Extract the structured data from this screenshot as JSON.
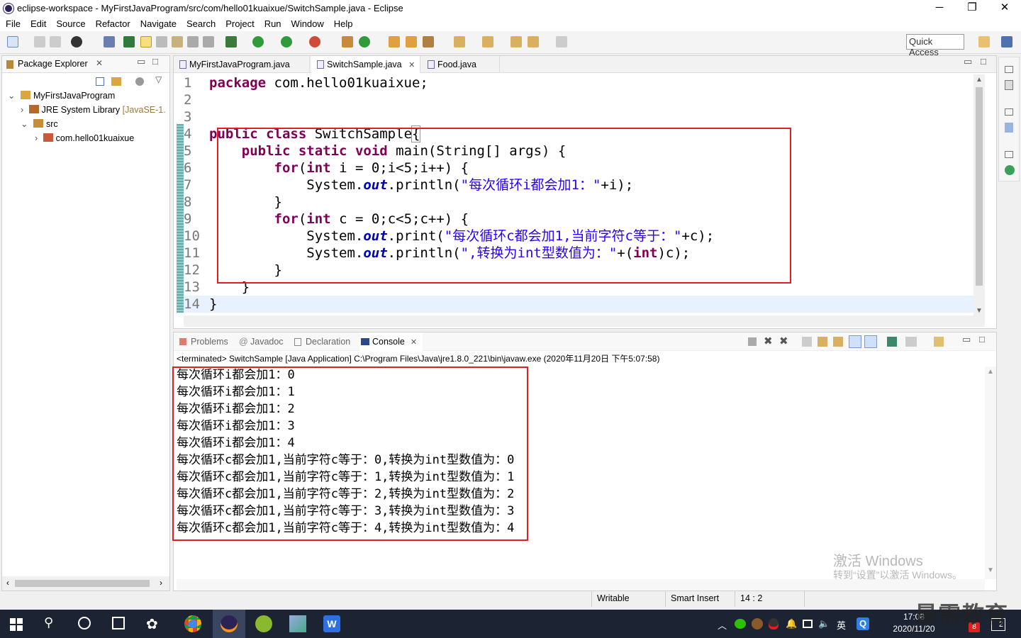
{
  "window": {
    "title": "eclipse-workspace - MyFirstJavaProgram/src/com/hello01kuaixue/SwitchSample.java - Eclipse"
  },
  "menu": [
    "File",
    "Edit",
    "Source",
    "Refactor",
    "Navigate",
    "Search",
    "Project",
    "Run",
    "Window",
    "Help"
  ],
  "quick_access": "Quick Access",
  "package_explorer": {
    "title": "Package Explorer",
    "tree": [
      {
        "label": "MyFirstJavaProgram"
      },
      {
        "label": "JRE System Library",
        "suffix": "[JavaSE-1."
      },
      {
        "label": "src"
      },
      {
        "label": "com.hello01kuaixue"
      }
    ]
  },
  "editor": {
    "tabs": [
      "MyFirstJavaProgram.java",
      "SwitchSample.java",
      "Food.java"
    ],
    "active_tab": 1,
    "line_numbers": [
      "1",
      "2",
      "3",
      "4",
      "5",
      "6",
      "7",
      "8",
      "9",
      "10",
      "11",
      "12",
      "13",
      "14"
    ]
  },
  "console": {
    "tabs": [
      "Problems",
      "Javadoc",
      "Declaration",
      "Console"
    ],
    "status": "<terminated> SwitchSample [Java Application] C:\\Program Files\\Java\\jre1.8.0_221\\bin\\javaw.exe (2020年11月20日 下午5:07:58)",
    "output": [
      "每次循环i都会加1：0",
      "每次循环i都会加1：1",
      "每次循环i都会加1：2",
      "每次循环i都会加1：3",
      "每次循环i都会加1：4",
      "每次循环c都会加1,当前字符c等于：0,转换为int型数值为：0",
      "每次循环c都会加1,当前字符c等于：1,转换为int型数值为：1",
      "每次循环c都会加1,当前字符c等于：2,转换为int型数值为：2",
      "每次循环c都会加1,当前字符c等于：3,转换为int型数值为：3",
      "每次循环c都会加1,当前字符c等于：4,转换为int型数值为：4"
    ],
    "watermark_line1": "激活 Windows",
    "watermark_line2": "转到“设置”以激活 Windows。"
  },
  "statusbar": {
    "writable": "Writable",
    "insert_mode": "Smart Insert",
    "position": "14 : 2"
  },
  "taskbar": {
    "time": "17:08",
    "date": "2020/11/20",
    "ime": "英",
    "badge": "8",
    "notif_count": "2"
  },
  "brand": "最需教育",
  "colors": {
    "keyword": "#7f0055",
    "string": "#2a00ff",
    "field": "#0000c0",
    "highlight": "#e02020",
    "taskbar": "#1c2433"
  }
}
